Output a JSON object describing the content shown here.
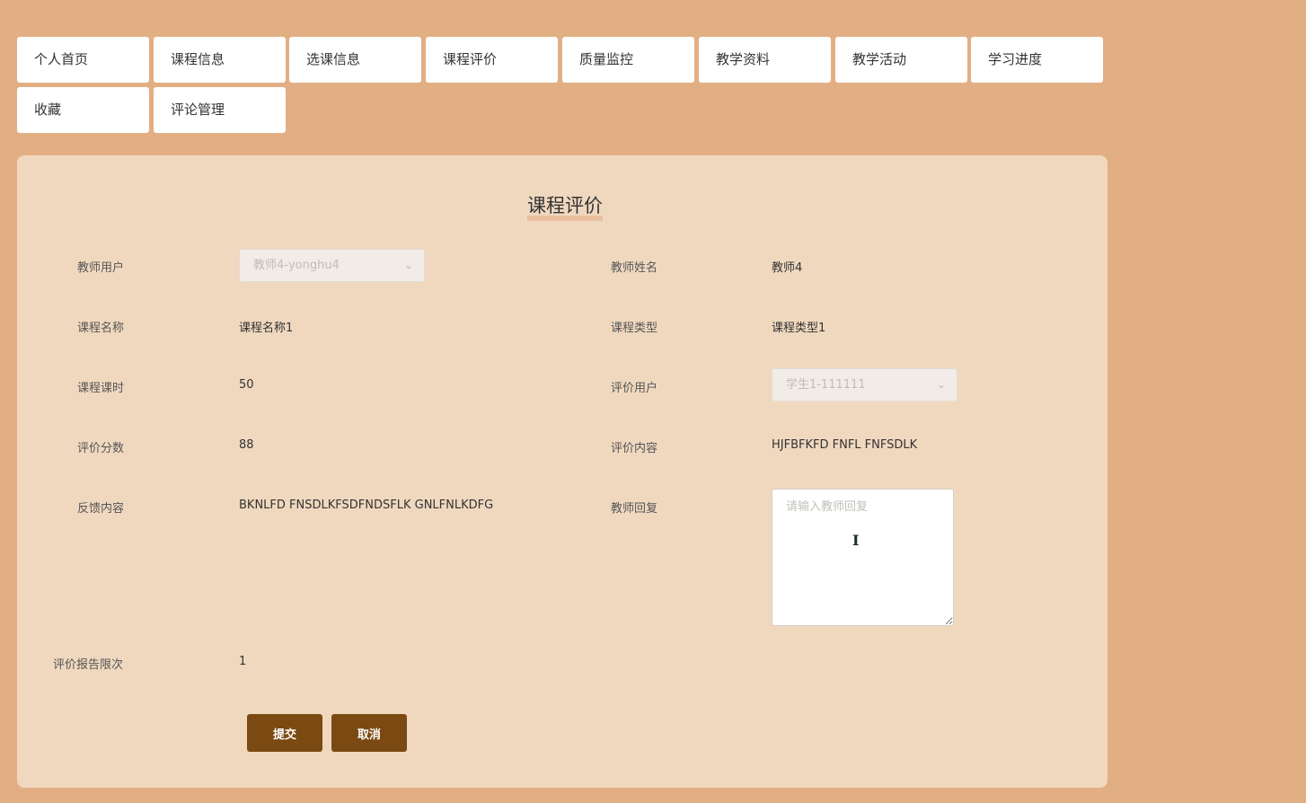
{
  "nav": {
    "items": [
      {
        "label": "个人首页"
      },
      {
        "label": "课程信息"
      },
      {
        "label": "选课信息"
      },
      {
        "label": "课程评价"
      },
      {
        "label": "质量监控"
      },
      {
        "label": "教学资料"
      },
      {
        "label": "教学活动"
      },
      {
        "label": "学习进度"
      },
      {
        "label": "收藏"
      },
      {
        "label": "评论管理"
      }
    ]
  },
  "form": {
    "title": "课程评价",
    "fields": {
      "teacher_user": {
        "label": "教师用户",
        "value": "教师4-yonghu4"
      },
      "teacher_name": {
        "label": "教师姓名",
        "value": "教师4"
      },
      "course_name": {
        "label": "课程名称",
        "value": "课程名称1"
      },
      "course_type": {
        "label": "课程类型",
        "value": "课程类型1"
      },
      "course_hours": {
        "label": "课程课时",
        "value": "50"
      },
      "review_user": {
        "label": "评价用户",
        "value": "学生1-111111"
      },
      "score": {
        "label": "评价分数",
        "value": "88"
      },
      "review_content": {
        "label": "评价内容",
        "value": "HJFBFKFD FNFL FNFSDLK"
      },
      "feedback": {
        "label": "反馈内容",
        "value": "BKNLFD FNSDLKFSDFNDSFLK GNLFNLKDFG"
      },
      "teacher_reply": {
        "label": "教师回复",
        "value": "",
        "placeholder": "请输入教师回复"
      },
      "report_limit": {
        "label": "评价报告限次",
        "value": "1"
      }
    },
    "submit_label": "提交",
    "cancel_label": "取消"
  }
}
